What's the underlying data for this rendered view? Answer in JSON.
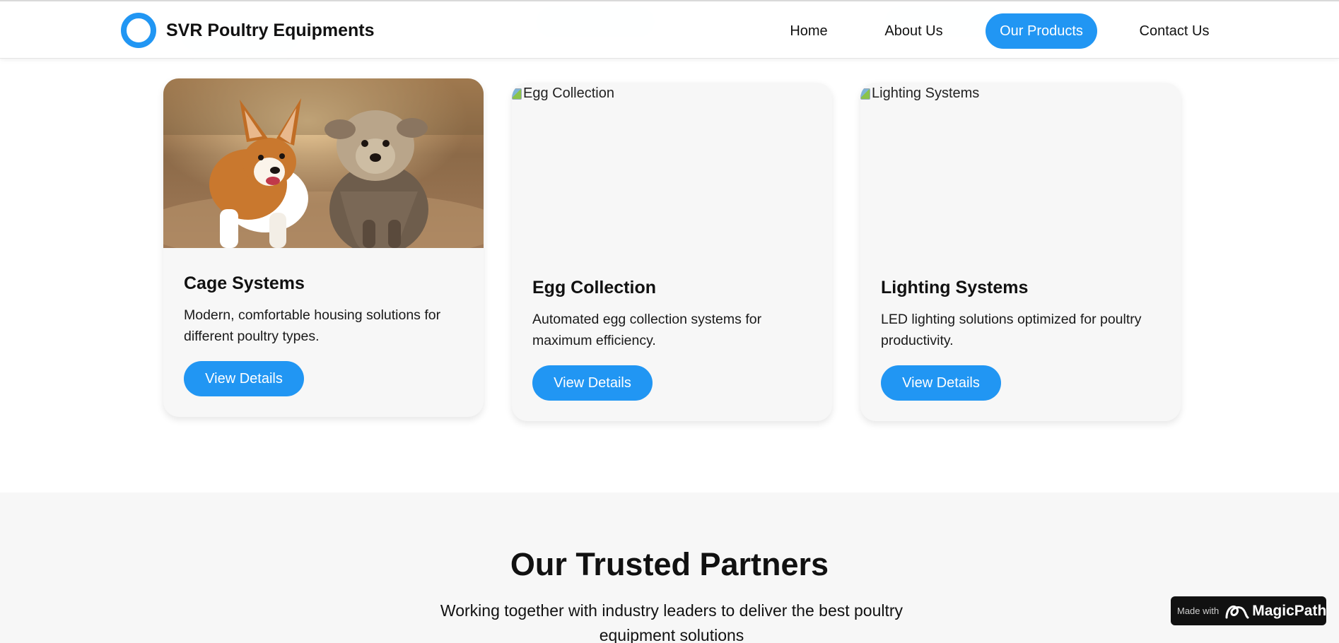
{
  "header": {
    "brand": "SVR Poultry Equipments",
    "nav": [
      {
        "label": "Home",
        "active": false
      },
      {
        "label": "About Us",
        "active": false
      },
      {
        "label": "Our Products",
        "active": true
      },
      {
        "label": "Contact Us",
        "active": false
      }
    ]
  },
  "products": [
    {
      "title": "Cage Systems",
      "description": "Modern, comfortable housing solutions for different poultry types.",
      "button": "View Details",
      "image": "dogs-photo"
    },
    {
      "title": "Egg Collection",
      "description": "Automated egg collection systems for maximum efficiency.",
      "button": "View Details",
      "image_alt": "Egg Collection"
    },
    {
      "title": "Lighting Systems",
      "description": "LED lighting solutions optimized for poultry productivity.",
      "button": "View Details",
      "image_alt": "Lighting Systems"
    }
  ],
  "partners": {
    "title": "Our Trusted Partners",
    "subtitle": "Working together with industry leaders to deliver the best poultry equipment solutions"
  },
  "badge": {
    "prefix": "Made with",
    "brand": "MagicPath"
  },
  "colors": {
    "accent": "#2196f3",
    "card_bg": "#f7f7f7",
    "section_bg": "#f7f7f7",
    "text": "#111111"
  }
}
